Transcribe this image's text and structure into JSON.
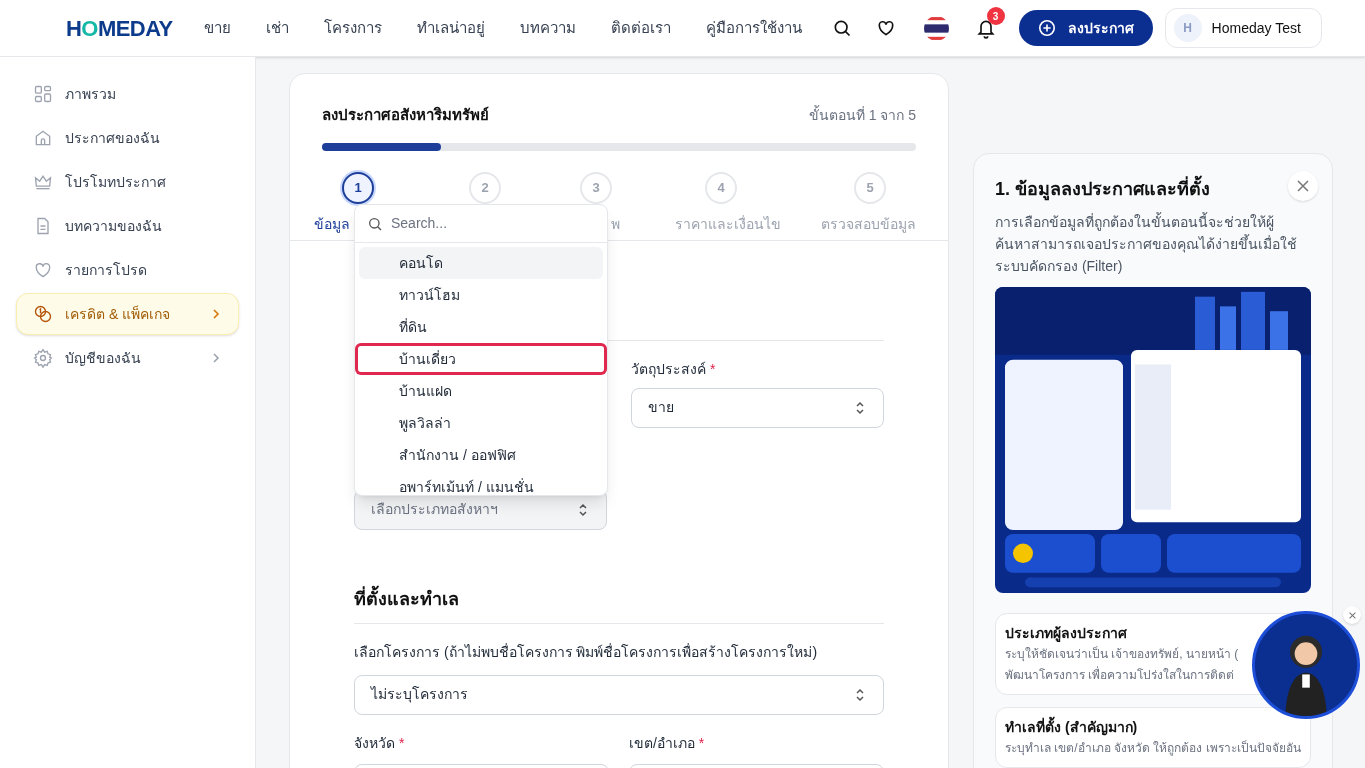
{
  "header": {
    "logo": "HOMEDAY",
    "nav": [
      "ขาย",
      "เช่า",
      "โครงการ",
      "ทำเลน่าอยู่",
      "บทความ",
      "ติดต่อเรา",
      "คู่มือการใช้งาน"
    ],
    "notification_count": "3",
    "post_button": "ลงประกาศ",
    "user": {
      "initial": "H",
      "name": "Homeday Test"
    }
  },
  "sidebar": {
    "items": [
      {
        "label": "ภาพรวม",
        "selected": false,
        "has_submenu": false
      },
      {
        "label": "ประกาศของฉัน",
        "selected": false,
        "has_submenu": false
      },
      {
        "label": "โปรโมทประกาศ",
        "selected": false,
        "has_submenu": false
      },
      {
        "label": "บทความของฉัน",
        "selected": false,
        "has_submenu": false
      },
      {
        "label": "รายการโปรด",
        "selected": false,
        "has_submenu": false
      },
      {
        "label": "เครดิต & แพ็คเกจ",
        "selected": true,
        "has_submenu": true
      },
      {
        "label": "บัญชีของฉัน",
        "selected": false,
        "has_submenu": true
      }
    ]
  },
  "form": {
    "title": "ลงประกาศอสังหาริมทรัพย์",
    "step_counter": "ขั้นตอนที่ 1 จาก 5",
    "progress": {
      "level": 0.2
    },
    "steps": [
      {
        "number": "1",
        "label": "ข้อมูล",
        "selected": true
      },
      {
        "number": "2",
        "selected": false
      },
      {
        "number": "3",
        "label": "พ",
        "selected": false
      },
      {
        "number": "4",
        "label": "ราคาและเงื่อนไข",
        "selected": false
      },
      {
        "number": "5",
        "label": "ตรวจสอบข้อมูล",
        "selected": false
      }
    ],
    "purpose": {
      "label": "วัตถุประสงค์",
      "required_mark": "*",
      "value": "ขาย"
    },
    "property_type": {
      "placeholder": "เลือกประเภทอสังหาฯ",
      "expanded": true
    },
    "type_dropdown": {
      "search_placeholder": "Search...",
      "options": [
        {
          "label": "คอนโด",
          "selected": true,
          "outlined": false
        },
        {
          "label": "ทาวน์โฮม",
          "selected": false,
          "outlined": false
        },
        {
          "label": "ที่ดิน",
          "selected": false,
          "outlined": false
        },
        {
          "label": "บ้านเดี่ยว",
          "selected": false,
          "outlined": true
        },
        {
          "label": "บ้านแฝด",
          "selected": false,
          "outlined": false
        },
        {
          "label": "พูลวิลล่า",
          "selected": false,
          "outlined": false
        },
        {
          "label": "สำนักงาน / ออฟฟิศ",
          "selected": false,
          "outlined": false
        },
        {
          "label": "อพาร์ทเม้นท์ / แมนชั่น",
          "selected": false,
          "outlined": false
        }
      ]
    },
    "location_section": {
      "title": "ที่ตั้งและทำเล",
      "project": {
        "label": "เลือกโครงการ (ถ้าไม่พบชื่อโครงการ พิมพ์ชื่อโครงการเพื่อสร้างโครงการใหม่)",
        "value": "ไม่ระบุโครงการ"
      },
      "province": {
        "label": "จังหวัด",
        "required_mark": "*"
      },
      "district": {
        "label": "เขต/อำเภอ",
        "required_mark": "*"
      }
    }
  },
  "help_panel": {
    "title": "1. ข้อมูลลงประกาศและที่ตั้ง",
    "description": "การเลือกข้อมูลที่ถูกต้องในขั้นตอนนี้จะช่วยให้ผู้ค้นหาสามารถเจอประกาศของคุณได้ง่ายขึ้นเมื่อใช้ระบบคัดกรอง (Filter)",
    "cards": [
      {
        "title": "ประเภทผู้ลงประกาศ",
        "text": "ระบุให้ชัดเจนว่าเป็น เจ้าของทรัพย์, นายหน้า (",
        "text_2": "พัฒนาโครงการ เพื่อความโปร่งใสในการติดต่"
      },
      {
        "title": "ทำเลที่ตั้ง (สำคัญมาก)",
        "text": "ระบุทำเล เขต/อำเภอ จังหวัด ให้ถูกต้อง เพราะเป็นปัจจัยอัน"
      }
    ]
  }
}
